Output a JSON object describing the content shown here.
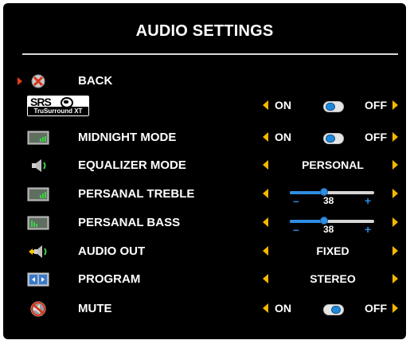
{
  "title": "AUDIO SETTINGS",
  "colors": {
    "accent_arrow": "#f5b800",
    "toggle_knob": "#1f88d8",
    "selection_pointer": "#e73b1c",
    "background": "#000000"
  },
  "items": [
    {
      "label": "BACK",
      "icon": "back-x-icon",
      "selected": true
    },
    {
      "label": "",
      "icon": "srs-trusurround-xt-logo",
      "logo_text_top": "SRS",
      "logo_text_bottom": "TruSurround XT",
      "control": "toggle",
      "on_label": "ON",
      "off_label": "OFF",
      "state": "on"
    },
    {
      "label": "MIDNIGHT MODE",
      "icon": "equalizer-display-icon",
      "control": "toggle",
      "on_label": "ON",
      "off_label": "OFF",
      "state": "on"
    },
    {
      "label": "EQUALIZER MODE",
      "icon": "speaker-icon",
      "control": "select",
      "value": "PERSONAL"
    },
    {
      "label": "PERSANAL TREBLE",
      "icon": "equalizer-display-icon",
      "control": "slider",
      "value": "38",
      "minus": "–",
      "plus": "+"
    },
    {
      "label": "PERSANAL BASS",
      "icon": "equalizer-display-icon",
      "control": "slider",
      "value": "38",
      "minus": "–",
      "plus": "+"
    },
    {
      "label": "AUDIO OUT",
      "icon": "speaker-arrow-icon",
      "control": "select",
      "value": "FIXED"
    },
    {
      "label": "PROGRAM",
      "icon": "program-icon",
      "control": "select",
      "value": "STEREO"
    },
    {
      "label": "MUTE",
      "icon": "mute-icon",
      "control": "toggle",
      "on_label": "ON",
      "off_label": "OFF",
      "state": "off"
    }
  ]
}
